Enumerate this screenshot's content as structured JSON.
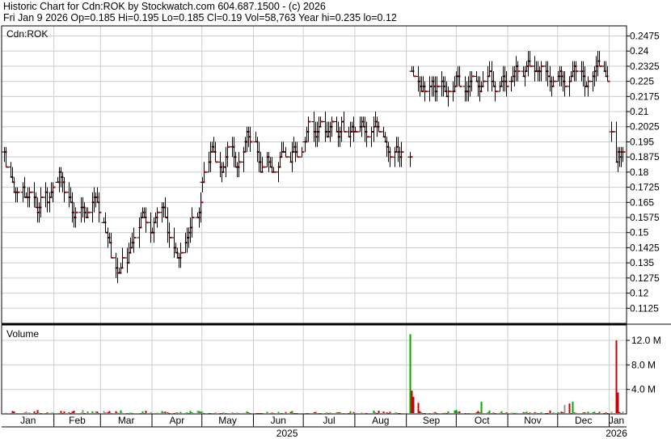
{
  "header": {
    "title_line": "Historic Chart for Cdn:ROK by Stockwatch.com 604.687.1500 - (c) 2026",
    "stats_line": "Fri Jan  9 2026  Op=0.185  Hi=0.195  Lo=0.185  Cl=0.19  Vol=58,763  Year hi=0.235  lo=0.12"
  },
  "colors": {
    "price_bar": "#000000",
    "close_tick": "#cc0000",
    "volume_up": "#00aa00",
    "volume_down": "#cc0000",
    "volume_flat": "#999999",
    "grid": "#cccccc"
  },
  "chart_data": [
    {
      "type": "ohlc",
      "symbol_label": "Cdn:ROK",
      "ylim": [
        0.105,
        0.2525
      ],
      "grid": true,
      "y_ticks": [
        "0.2475",
        "0.24",
        "0.2325",
        "0.225",
        "0.2175",
        "0.21",
        "0.2025",
        "0.195",
        "0.1875",
        "0.18",
        "0.1725",
        "0.165",
        "0.1575",
        "0.15",
        "0.1425",
        "0.135",
        "0.1275",
        "0.12",
        "0.1125"
      ],
      "x_month_labels": [
        "Jan",
        "Feb",
        "Mar",
        "Apr",
        "May",
        "Jun",
        "Jul",
        "Aug",
        "Sep",
        "Oct",
        "Nov",
        "Dec",
        "Jan"
      ],
      "x_year_labels": [
        "2025",
        "2026"
      ],
      "date_range": [
        "2025-01-02",
        "2026-01-09"
      ],
      "segments": [
        {
          "from": "2025-01-02",
          "to": "2025-01-31",
          "path": [
            0.19,
            0.18,
            0.175,
            0.17,
            0.168,
            0.172,
            0.165,
            0.168,
            0.17,
            0.165,
            0.16,
            0.165,
            0.17,
            0.165,
            0.168,
            0.172
          ]
        },
        {
          "from": "2025-02-03",
          "to": "2025-02-28",
          "path": [
            0.175,
            0.18,
            0.178,
            0.172,
            0.168,
            0.165,
            0.16,
            0.158,
            0.162,
            0.165,
            0.16,
            0.158,
            0.162,
            0.165,
            0.168,
            0.165,
            0.16
          ]
        },
        {
          "from": "2025-03-03",
          "to": "2025-03-31",
          "path": [
            0.155,
            0.15,
            0.148,
            0.142,
            0.135,
            0.13,
            0.128,
            0.132,
            0.138,
            0.135,
            0.14,
            0.142,
            0.145,
            0.15,
            0.155,
            0.16,
            0.158,
            0.155,
            0.15
          ]
        },
        {
          "from": "2025-04-01",
          "to": "2025-04-30",
          "path": [
            0.15,
            0.155,
            0.16,
            0.162,
            0.165,
            0.158,
            0.15,
            0.148,
            0.142,
            0.138,
            0.135,
            0.14,
            0.145,
            0.148,
            0.152,
            0.155,
            0.158,
            0.16,
            0.165
          ]
        },
        {
          "from": "2025-05-01",
          "to": "2025-05-30",
          "path": [
            0.175,
            0.18,
            0.185,
            0.19,
            0.192,
            0.188,
            0.185,
            0.18,
            0.178,
            0.185,
            0.19,
            0.195,
            0.19,
            0.185,
            0.18,
            0.185,
            0.19,
            0.195,
            0.2,
            0.198,
            0.195
          ]
        },
        {
          "from": "2025-06-02",
          "to": "2025-06-30",
          "path": [
            0.195,
            0.19,
            0.185,
            0.18,
            0.182,
            0.188,
            0.185,
            0.18,
            0.178,
            0.182,
            0.185,
            0.188,
            0.19,
            0.188,
            0.185,
            0.19,
            0.192,
            0.19,
            0.188,
            0.19
          ]
        },
        {
          "from": "2025-07-02",
          "to": "2025-07-31",
          "path": [
            0.195,
            0.2,
            0.205,
            0.2,
            0.198,
            0.2,
            0.202,
            0.205,
            0.2,
            0.198,
            0.2,
            0.202,
            0.205,
            0.2,
            0.198,
            0.2,
            0.205,
            0.2,
            0.198,
            0.2,
            0.202,
            0.2
          ]
        },
        {
          "from": "2025-08-01",
          "to": "2025-08-29",
          "path": [
            0.2,
            0.202,
            0.205,
            0.202,
            0.2,
            0.198,
            0.2,
            0.202,
            0.205,
            0.2,
            0.198,
            0.195,
            0.192,
            0.19,
            0.188,
            0.19,
            0.192,
            0.19,
            0.188,
            0.19
          ]
        },
        {
          "from": "2025-09-03",
          "to": "2025-09-03",
          "path": [
            0.188
          ]
        },
        {
          "from": "2025-09-04",
          "to": "2025-10-31",
          "path": [
            0.23,
            0.228,
            0.225,
            0.222,
            0.22,
            0.222,
            0.22,
            0.222,
            0.225,
            0.222,
            0.22,
            0.222,
            0.225,
            0.222,
            0.22,
            0.218,
            0.22,
            0.222,
            0.225,
            0.228,
            0.225,
            0.222,
            0.22,
            0.222,
            0.225,
            0.228,
            0.225,
            0.222,
            0.22,
            0.222,
            0.225,
            0.228,
            0.23,
            0.225,
            0.222,
            0.22,
            0.222,
            0.225,
            0.228,
            0.225,
            0.222
          ]
        },
        {
          "from": "2025-11-03",
          "to": "2025-12-31",
          "path": [
            0.225,
            0.228,
            0.23,
            0.232,
            0.23,
            0.228,
            0.23,
            0.232,
            0.235,
            0.232,
            0.23,
            0.228,
            0.23,
            0.232,
            0.23,
            0.228,
            0.225,
            0.222,
            0.225,
            0.228,
            0.23,
            0.228,
            0.225,
            0.222,
            0.225,
            0.228,
            0.23,
            0.232,
            0.23,
            0.228,
            0.225,
            0.222,
            0.225,
            0.228,
            0.23,
            0.232,
            0.235,
            0.232,
            0.23,
            0.228,
            0.225
          ]
        },
        {
          "from": "2026-01-02",
          "to": "2026-01-09",
          "path": [
            0.2,
            0.185,
            0.19,
            0.188,
            0.19,
            0.19
          ]
        }
      ]
    },
    {
      "type": "bar",
      "title": "Volume",
      "ylim": [
        0,
        14.5
      ],
      "y_ticks": [
        "4.0 M",
        "8.0 M",
        "12.0 M"
      ],
      "unit": "M",
      "spikes": [
        {
          "date": "2025-09-03",
          "value": 13.0,
          "direction": "up"
        },
        {
          "date": "2025-09-04",
          "value": 3.8,
          "direction": "down"
        },
        {
          "date": "2025-09-05",
          "value": 2.8,
          "direction": "down"
        },
        {
          "date": "2025-09-08",
          "value": 1.8,
          "direction": "down"
        },
        {
          "date": "2025-10-16",
          "value": 2.0,
          "direction": "up"
        },
        {
          "date": "2025-12-05",
          "value": 1.5,
          "direction": "flat"
        },
        {
          "date": "2025-12-08",
          "value": 1.7,
          "direction": "down"
        },
        {
          "date": "2025-12-10",
          "value": 2.0,
          "direction": "up"
        },
        {
          "date": "2026-01-05",
          "value": 12.0,
          "direction": "down"
        },
        {
          "date": "2026-01-06",
          "value": 3.5,
          "direction": "down"
        }
      ],
      "typical_volume_range": [
        0.05,
        0.7
      ]
    }
  ]
}
